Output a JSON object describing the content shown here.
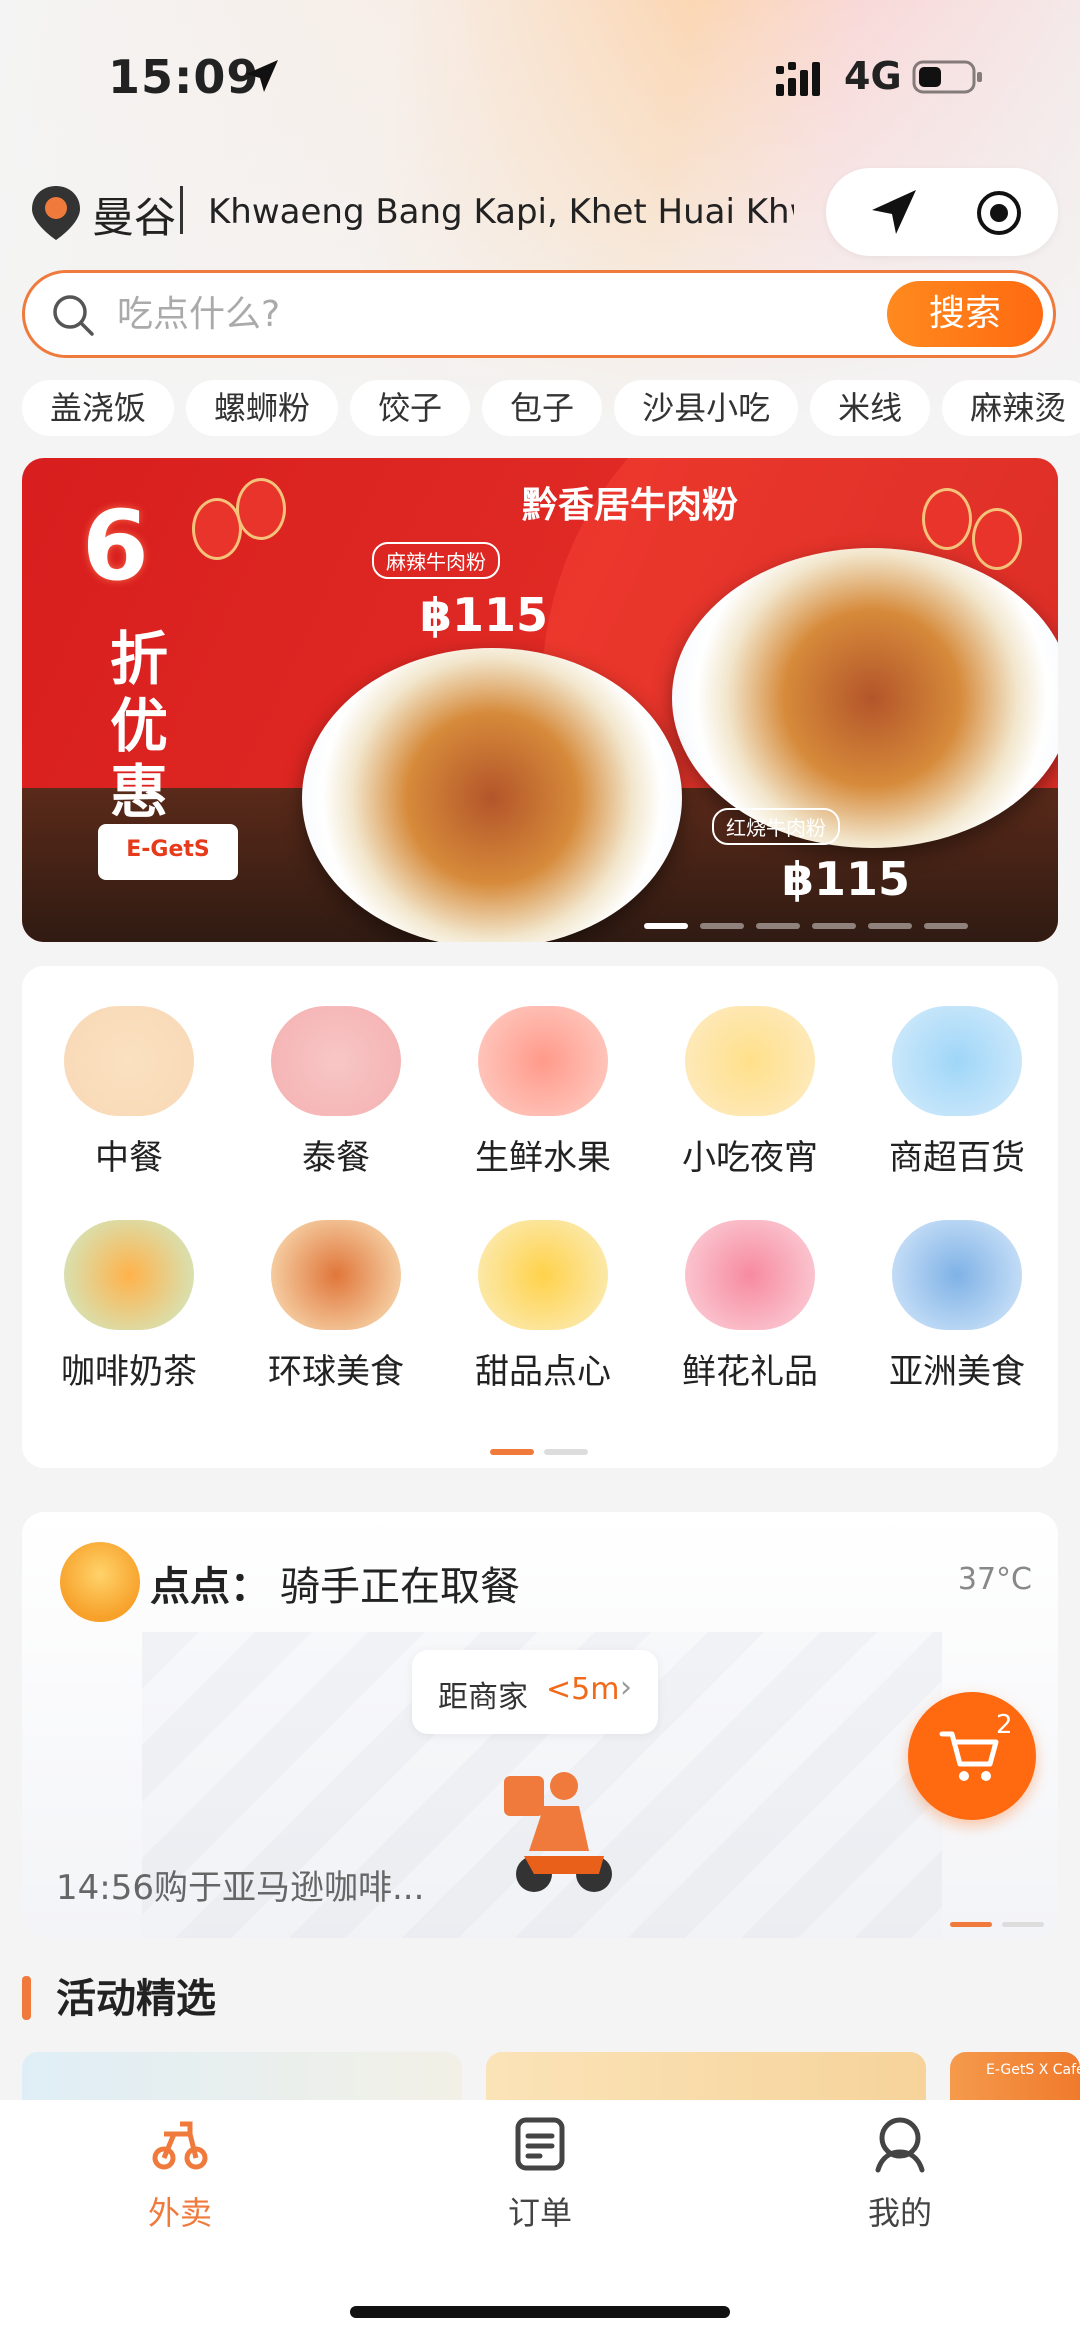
{
  "status_bar": {
    "time": "15:09",
    "network": "4G"
  },
  "location": {
    "city": "曼谷",
    "address": "Khwaeng Bang Kapi, Khet Huai Khwang, Bangkok"
  },
  "search": {
    "placeholder": "吃点什么?",
    "button_label": "搜索"
  },
  "chips": [
    "盖浇饭",
    "螺蛳粉",
    "饺子",
    "包子",
    "沙县小吃",
    "米线",
    "麻辣烫"
  ],
  "banner": {
    "title": "黔香居牛肉粉",
    "discount_big": "6",
    "discount_text": "折优惠",
    "brand": "E-GetS",
    "dish1_label": "麻辣牛肉粉",
    "dish1_price": "฿115",
    "dish2_label": "红烧牛肉粉",
    "dish2_price": "฿115"
  },
  "categories": [
    {
      "label": "中餐",
      "icon": "dumpling-icon"
    },
    {
      "label": "泰餐",
      "icon": "thai-food-icon"
    },
    {
      "label": "生鲜水果",
      "icon": "watermelon-icon"
    },
    {
      "label": "小吃夜宵",
      "icon": "fries-icon"
    },
    {
      "label": "商超百货",
      "icon": "detergent-icon"
    },
    {
      "label": "咖啡奶茶",
      "icon": "coffee-icon"
    },
    {
      "label": "环球美食",
      "icon": "burger-icon"
    },
    {
      "label": "甜品点心",
      "icon": "pancake-icon"
    },
    {
      "label": "鲜花礼品",
      "icon": "rose-icon"
    },
    {
      "label": "亚洲美食",
      "icon": "asian-bowl-icon"
    }
  ],
  "rider_card": {
    "name": "点点：",
    "status": "骑手正在取餐",
    "temperature": "37°C",
    "distance_label": "距商家",
    "distance_value": "<5m",
    "order_text": "14:56购于亚马逊咖啡..."
  },
  "cart": {
    "count": "2"
  },
  "activities": {
    "title": "活动精选",
    "card3_text": "E-GetS X Cafe Ama"
  },
  "bottom_nav": [
    {
      "label": "外卖",
      "icon": "scooter-icon",
      "active": true
    },
    {
      "label": "订单",
      "icon": "order-icon",
      "active": false
    },
    {
      "label": "我的",
      "icon": "profile-icon",
      "active": false
    }
  ],
  "colors": {
    "accent": "#f07a3c",
    "cta": "#ff6a10",
    "banner_red": "#d81e1e"
  }
}
